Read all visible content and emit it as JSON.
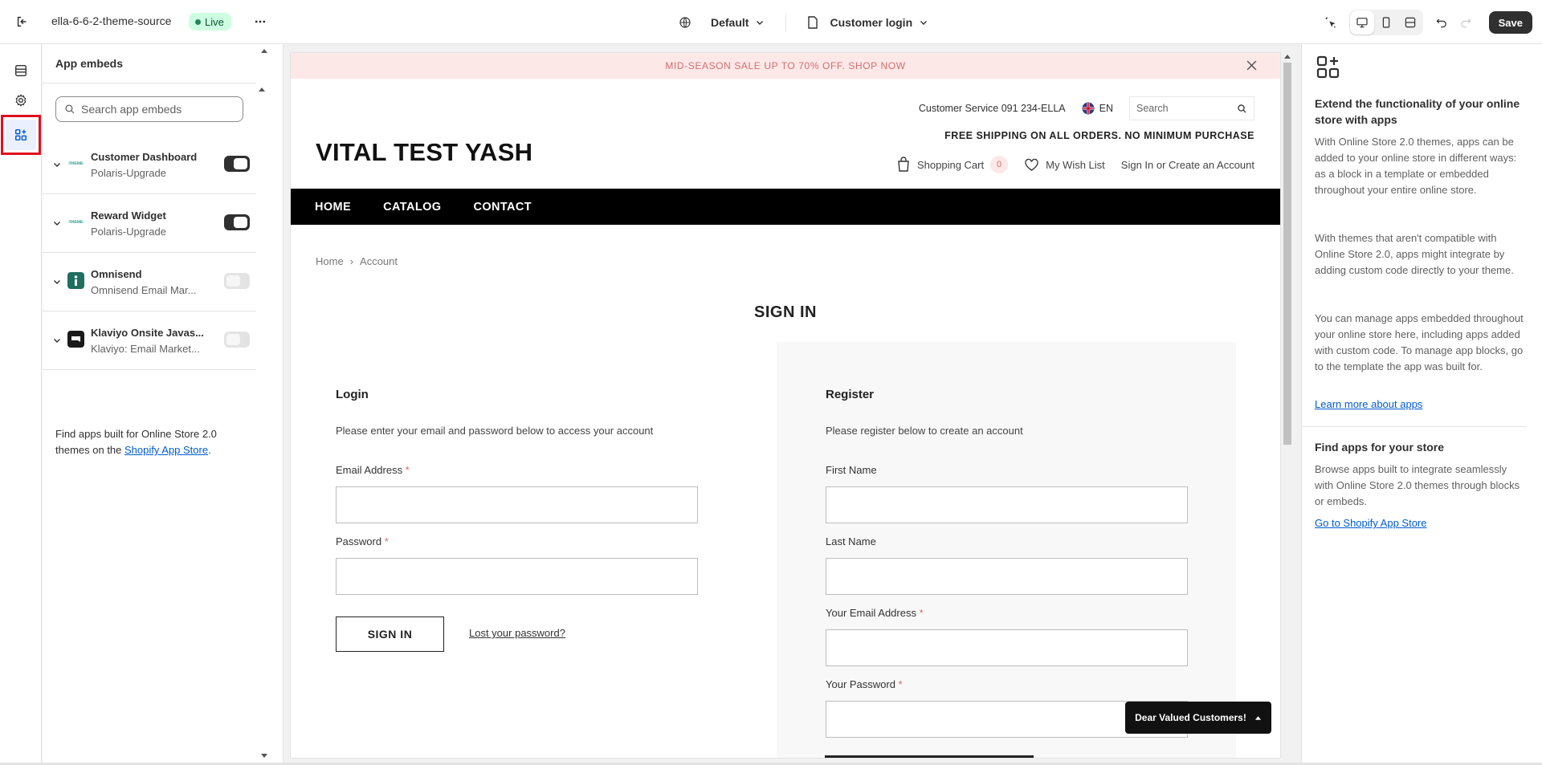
{
  "topbar": {
    "theme_name": "ella-6-6-2-theme-source",
    "live_label": "Live",
    "template_label": "Default",
    "page_label": "Customer login",
    "save_label": "Save",
    "icons": [
      "exit-icon",
      "more-horizontal-icon",
      "globe-icon",
      "page-icon",
      "inspector-icon",
      "desktop-icon",
      "mobile-icon",
      "fullscreen-icon",
      "undo-icon",
      "redo-icon"
    ]
  },
  "rail": {
    "items": [
      {
        "name": "sections",
        "icon": "sections-icon"
      },
      {
        "name": "theme-settings",
        "icon": "gear-icon"
      },
      {
        "name": "app-embeds",
        "icon": "apps-icon"
      }
    ]
  },
  "embeds_panel": {
    "title": "App embeds",
    "search_placeholder": "Search app embeds",
    "items": [
      {
        "name": "Customer Dashboard",
        "sub": "Polaris-Upgrade",
        "enabled": true,
        "logo_color": "#2a9d8f"
      },
      {
        "name": "Reward Widget",
        "sub": "Polaris-Upgrade",
        "enabled": true,
        "logo_color": "#2a9d8f"
      },
      {
        "name": "Omnisend",
        "sub": "Omnisend Email Mar...",
        "enabled": false,
        "logo_color": "#1f6f5f"
      },
      {
        "name": "Klaviyo Onsite Javas...",
        "sub": "Klaviyo: Email Market...",
        "enabled": false,
        "logo_color": "#1a1a1a"
      }
    ],
    "footer_text": "Find apps built for Online Store 2.0 themes on the",
    "footer_link": "Shopify App Store",
    "footer_end": "."
  },
  "preview": {
    "announcement": "MID-SEASON SALE UP TO 70% OFF. SHOP NOW",
    "customer_service": "Customer Service 091 234-ELLA",
    "language": "EN",
    "search_placeholder": "Search",
    "shipping": "FREE SHIPPING ON ALL ORDERS. NO MINIMUM PURCHASE",
    "store_name": "VITAL TEST YASH",
    "cart_label": "Shopping Cart",
    "cart_count": "0",
    "wishlist_label": "My Wish List",
    "account_label": "Sign In or Create an Account",
    "nav": [
      "HOME",
      "CATALOG",
      "CONTACT"
    ],
    "breadcrumb": {
      "home": "Home",
      "sep": "›",
      "current": "Account"
    },
    "page_title": "SIGN IN",
    "login": {
      "title": "Login",
      "desc": "Please enter your email and password below to access your account",
      "email_label": "Email Address",
      "password_label": "Password",
      "required_mark": "*",
      "submit": "SIGN IN",
      "lost_password": "Lost your password?"
    },
    "register": {
      "title": "Register",
      "desc": "Please register below to create an account",
      "first_name": "First Name",
      "last_name": "Last Name",
      "email_label": "Your Email Address",
      "password_label": "Your Password",
      "required_mark": "*"
    },
    "chat_label": "Dear Valued Customers!",
    "accent_color": "#d26e6e"
  },
  "right_panel": {
    "heading1": "Extend the functionality of your online store with apps",
    "p1": "With Online Store 2.0 themes, apps can be added to your online store in different ways: as a block in a template or embedded throughout your entire online store.",
    "p2": "With themes that aren't compatible with Online Store 2.0, apps might integrate by adding custom code directly to your theme.",
    "p3": "You can manage apps embedded throughout your online store here, including apps added with custom code. To manage app blocks, go to the template the app was built for.",
    "link1": "Learn more about apps",
    "heading2": "Find apps for your store",
    "p4": "Browse apps built to integrate seamlessly with Online Store 2.0 themes through blocks or embeds.",
    "link2": "Go to Shopify App Store"
  }
}
